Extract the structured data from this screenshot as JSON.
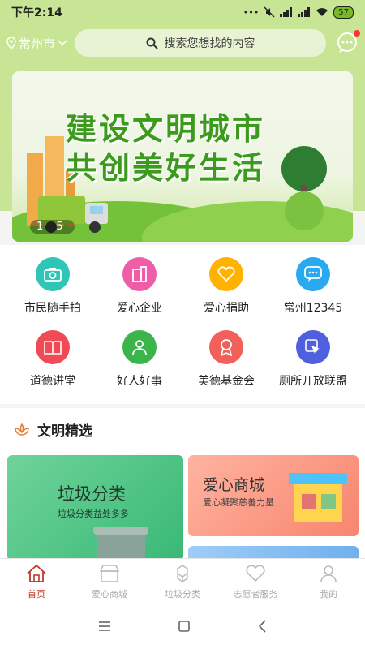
{
  "status": {
    "time": "下午2:14",
    "battery": "57"
  },
  "header": {
    "city": "常州市",
    "search_placeholder": "搜索您想找的内容"
  },
  "banner": {
    "line1": "建设文明城市",
    "line2": "共创美好生活",
    "pager": "1 5"
  },
  "quick_menu": [
    {
      "label": "市民随手拍",
      "icon": "camera-icon",
      "color": "#2fc6b8"
    },
    {
      "label": "爱心企业",
      "icon": "building-icon",
      "color": "#ef5da8"
    },
    {
      "label": "爱心捐助",
      "icon": "heart-icon",
      "color": "#ffb300"
    },
    {
      "label": "常州12345",
      "icon": "chat-icon",
      "color": "#29a9f0"
    },
    {
      "label": "道德讲堂",
      "icon": "book-icon",
      "color": "#f04a55"
    },
    {
      "label": "好人好事",
      "icon": "person-icon",
      "color": "#39b54a"
    },
    {
      "label": "美德基金会",
      "icon": "medal-icon",
      "color": "#f2605a"
    },
    {
      "label": "厕所开放联盟",
      "icon": "cursor-icon",
      "color": "#4f5fe0"
    }
  ],
  "section": {
    "title": "文明精选",
    "card1": {
      "title": "垃圾分类",
      "subtitle": "垃圾分类益处多多"
    },
    "card2": {
      "title": "爱心商城",
      "subtitle": "爱心凝聚慈善力量"
    }
  },
  "tabbar": [
    {
      "label": "首页",
      "icon": "home-icon",
      "active": true
    },
    {
      "label": "爱心商城",
      "icon": "shop-icon",
      "active": false
    },
    {
      "label": "垃圾分类",
      "icon": "sort-icon",
      "active": false
    },
    {
      "label": "志愿者服务",
      "icon": "heart-outline-icon",
      "active": false
    },
    {
      "label": "我的",
      "icon": "profile-icon",
      "active": false
    }
  ],
  "colors": {
    "accent": "#c0392b",
    "top_bg": "#c8e596"
  }
}
